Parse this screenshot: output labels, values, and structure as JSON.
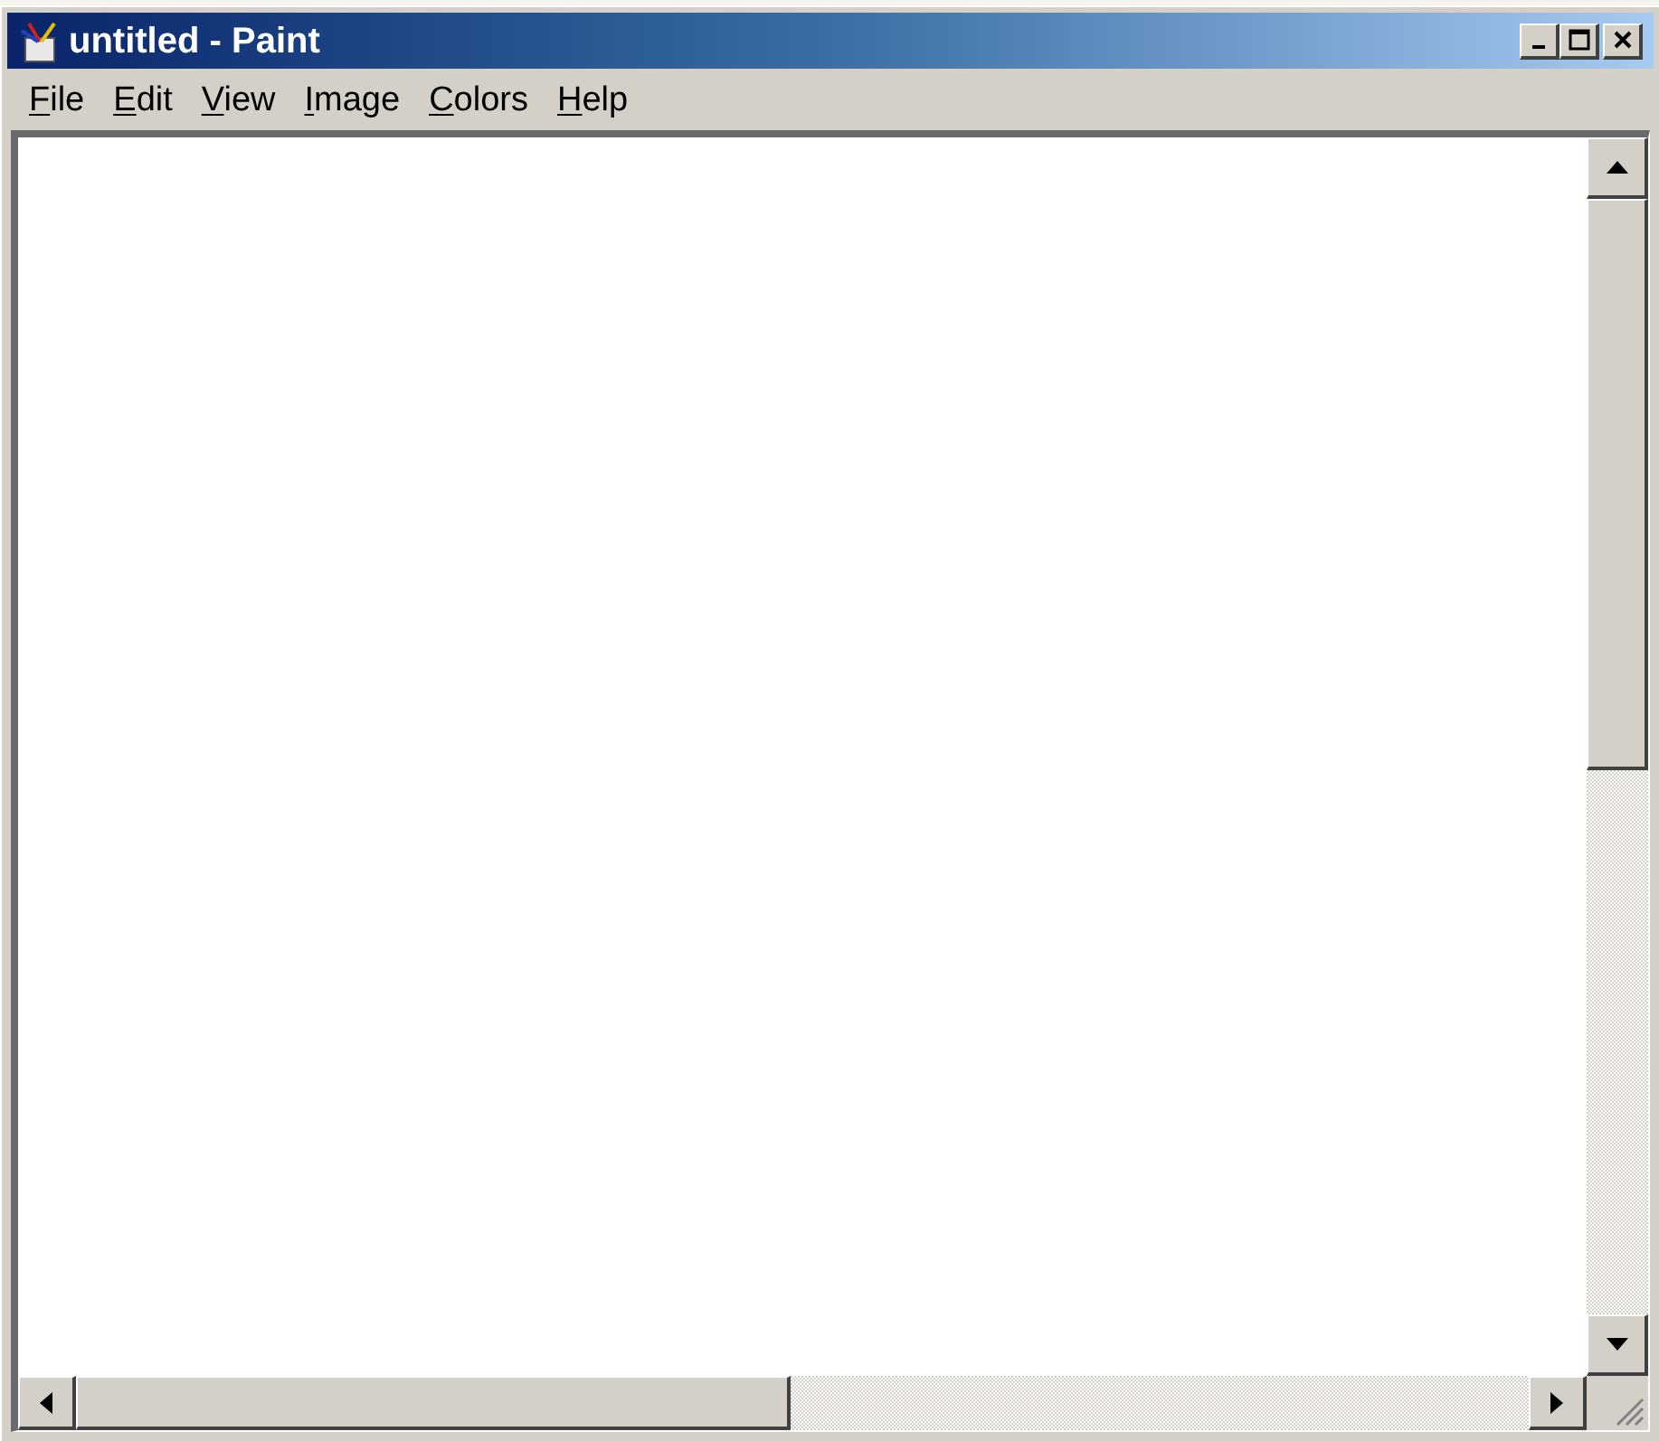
{
  "window": {
    "title": "untitled - Paint"
  },
  "menu": [
    {
      "label": "File"
    },
    {
      "label": "Edit"
    },
    {
      "label": "View"
    },
    {
      "label": "Image"
    },
    {
      "label": "Colors"
    },
    {
      "label": "Help"
    }
  ]
}
